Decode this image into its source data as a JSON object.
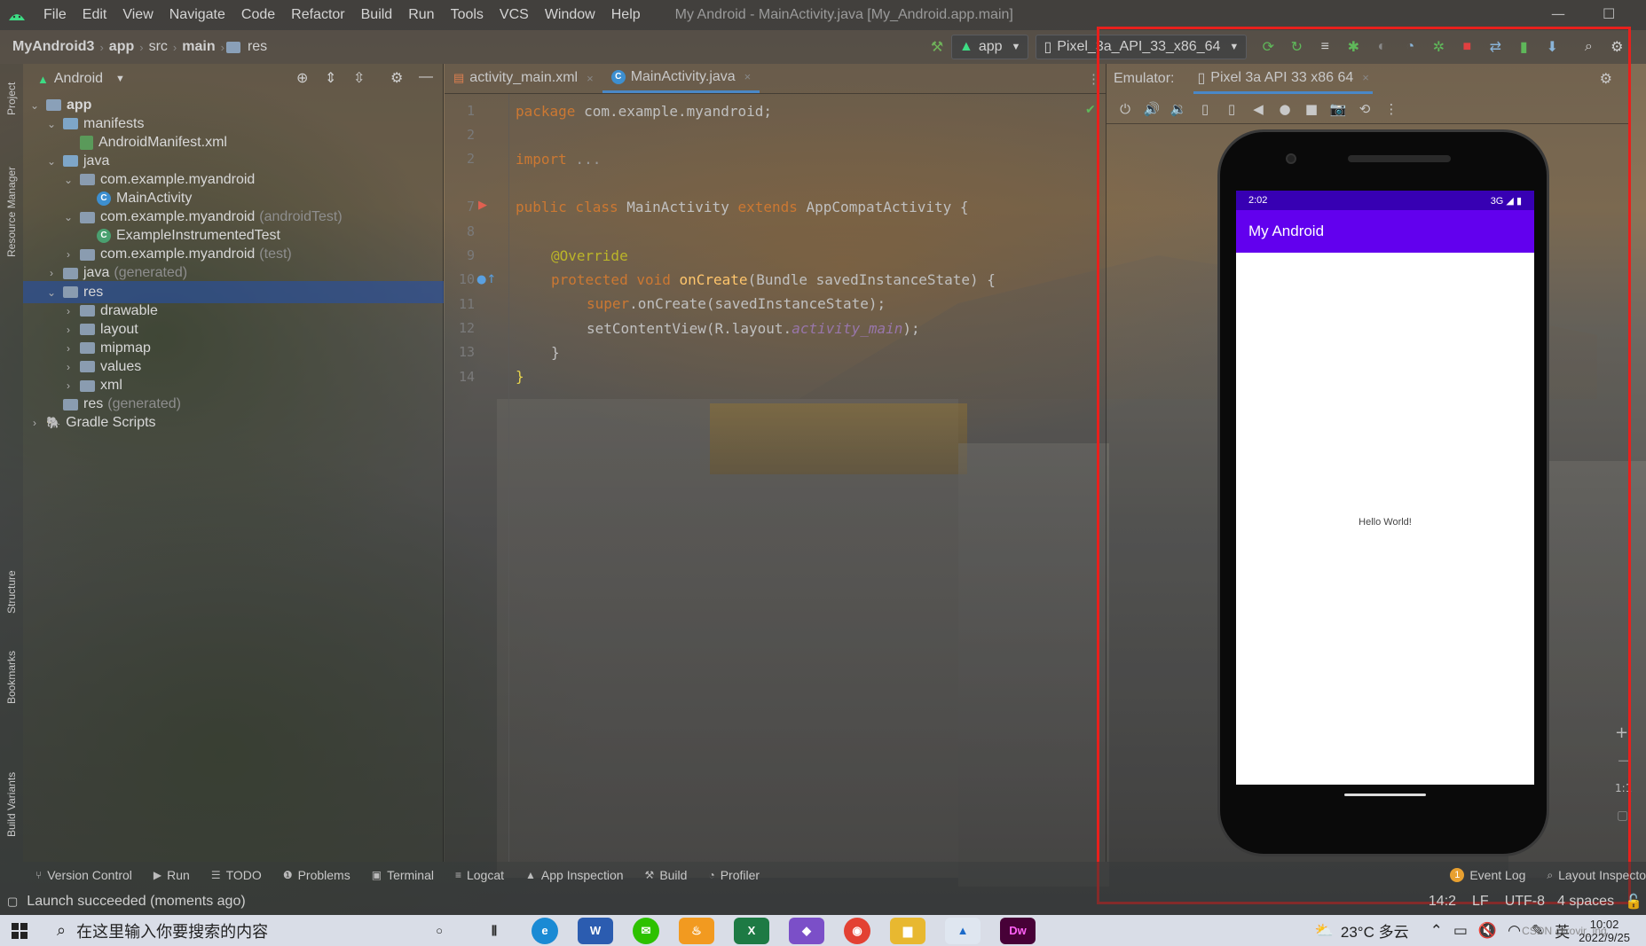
{
  "menu": {
    "items": [
      "File",
      "Edit",
      "View",
      "Navigate",
      "Code",
      "Refactor",
      "Build",
      "Run",
      "Tools",
      "VCS",
      "Window",
      "Help"
    ],
    "window_title": "My Android - MainActivity.java [My_Android.app.main]"
  },
  "breadcrumb": [
    "MyAndroid3",
    "app",
    "src",
    "main",
    "res"
  ],
  "toolbar": {
    "run_config": "app",
    "device": "Pixel_3a_API_33_x86_64"
  },
  "left_stripe": [
    "Project",
    "Resource Manager",
    "Structure",
    "Bookmarks",
    "Build Variants"
  ],
  "project": {
    "view_mode": "Android",
    "tree": [
      {
        "label": "app",
        "suffix": "",
        "depth": 0,
        "expanded": true,
        "icon": "module",
        "bold": true
      },
      {
        "label": "manifests",
        "suffix": "",
        "depth": 1,
        "expanded": true,
        "icon": "folder"
      },
      {
        "label": "AndroidManifest.xml",
        "suffix": "",
        "depth": 2,
        "icon": "manifest-file"
      },
      {
        "label": "java",
        "suffix": "",
        "depth": 1,
        "expanded": true,
        "icon": "folder"
      },
      {
        "label": "com.example.myandroid",
        "suffix": "",
        "depth": 2,
        "expanded": true,
        "icon": "package"
      },
      {
        "label": "MainActivity",
        "suffix": "",
        "depth": 3,
        "icon": "class"
      },
      {
        "label": "com.example.myandroid",
        "suffix": "(androidTest)",
        "depth": 2,
        "expanded": true,
        "icon": "package"
      },
      {
        "label": "ExampleInstrumentedTest",
        "suffix": "",
        "depth": 3,
        "icon": "test-class"
      },
      {
        "label": "com.example.myandroid",
        "suffix": "(test)",
        "depth": 2,
        "expanded": false,
        "icon": "package"
      },
      {
        "label": "java",
        "suffix": "(generated)",
        "depth": 1,
        "expanded": false,
        "icon": "folder-gen"
      },
      {
        "label": "res",
        "suffix": "",
        "depth": 1,
        "expanded": true,
        "icon": "res-folder",
        "selected": true
      },
      {
        "label": "drawable",
        "suffix": "",
        "depth": 2,
        "expanded": false,
        "icon": "package"
      },
      {
        "label": "layout",
        "suffix": "",
        "depth": 2,
        "expanded": false,
        "icon": "package"
      },
      {
        "label": "mipmap",
        "suffix": "",
        "depth": 2,
        "expanded": false,
        "icon": "package"
      },
      {
        "label": "values",
        "suffix": "",
        "depth": 2,
        "expanded": false,
        "icon": "package"
      },
      {
        "label": "xml",
        "suffix": "",
        "depth": 2,
        "expanded": false,
        "icon": "package"
      },
      {
        "label": "res",
        "suffix": "(generated)",
        "depth": 1,
        "icon": "res-folder"
      },
      {
        "label": "Gradle Scripts",
        "suffix": "",
        "depth": 0,
        "expanded": false,
        "icon": "gradle"
      }
    ]
  },
  "editor": {
    "tabs": [
      {
        "label": "activity_main.xml",
        "active": false
      },
      {
        "label": "MainActivity.java",
        "active": true
      }
    ],
    "line_numbers": [
      "1",
      "2",
      "3",
      "7",
      "8",
      "9",
      "10",
      "11",
      "12",
      "13",
      "14"
    ],
    "code": {
      "l1_kw": "package",
      "l1_rest": " com.example.myandroid;",
      "l3_kw": "import",
      "l3_rest": " ...",
      "l7_kw1": "public class",
      "l7_name": " MainActivity ",
      "l7_kw2": "extends",
      "l7_rest": " AppCompatActivity {",
      "l9_ann": "@Override",
      "l10_kw": "protected void",
      "l10_fn": " onCreate",
      "l10_rest": "(Bundle savedInstanceState) {",
      "l11_kw": "super",
      "l11_rest": ".onCreate(savedInstanceState);",
      "l12_pre": "setContentView(R.layout.",
      "l12_it": "activity_main",
      "l12_post": ");",
      "l13": "}",
      "l14": "}"
    }
  },
  "emulator": {
    "label": "Emulator:",
    "device_tab": "Pixel 3a API 33 x86 64",
    "phone": {
      "time": "2:02",
      "network": "3G",
      "app_title": "My Android",
      "content": "Hello World!"
    }
  },
  "bottom_tools": [
    "Version Control",
    "Run",
    "TODO",
    "Problems",
    "Terminal",
    "Logcat",
    "App Inspection",
    "Build",
    "Profiler"
  ],
  "bottom_right_tools": {
    "event_log": "Event Log",
    "event_count": "1",
    "layout_inspector": "Layout Inspecto"
  },
  "status": {
    "message": "Launch succeeded (moments ago)",
    "position": "14:2",
    "line_sep": "LF",
    "encoding": "UTF-8",
    "indent": "4 spaces"
  },
  "taskbar": {
    "search_placeholder": "在这里输入你要搜索的内容",
    "weather": "23°C 多云",
    "ime": "英",
    "time": "10:02",
    "date": "2022/9/25",
    "watermark": "CSDN @rovir_ing"
  },
  "colors": {
    "accent_blue": "#4a88c7",
    "app_bar": "#6200ee",
    "status_bar": "#3700b3",
    "highlight_box": "#e8201c",
    "keyword": "#cc7832",
    "annotation": "#bbb529",
    "function": "#ffc66d",
    "field_italic": "#9876aa"
  }
}
